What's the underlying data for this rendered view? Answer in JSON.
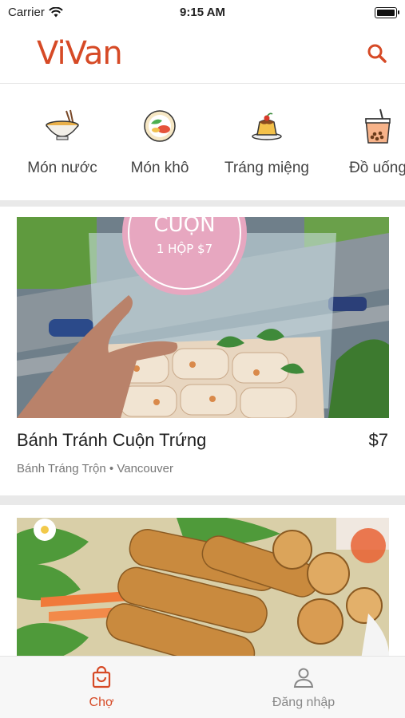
{
  "status_bar": {
    "carrier": "Carrier",
    "time": "9:15 AM"
  },
  "header": {
    "logo": "ViVan"
  },
  "categories": [
    {
      "label": "Món nước",
      "icon": "noodle-bowl-icon"
    },
    {
      "label": "Món khô",
      "icon": "rice-plate-icon"
    },
    {
      "label": "Tráng miệng",
      "icon": "pudding-icon"
    },
    {
      "label": "Đồ uống",
      "icon": "bubble-tea-icon"
    }
  ],
  "listings": [
    {
      "title": "Bánh Tránh Cuộn Trứng",
      "price": "$7",
      "seller": "Bánh Tráng Trộn",
      "location": "Vancouver",
      "photo_text": {
        "line1": "CUỘN",
        "line2": "1 HỘP $7"
      }
    }
  ],
  "tab_bar": {
    "items": [
      {
        "label": "Chợ",
        "icon": "shopping-bag-icon",
        "active": true
      },
      {
        "label": "Đăng nhập",
        "icon": "user-icon",
        "active": false
      }
    ]
  },
  "colors": {
    "accent": "#d64a26",
    "inactive": "#888888"
  }
}
